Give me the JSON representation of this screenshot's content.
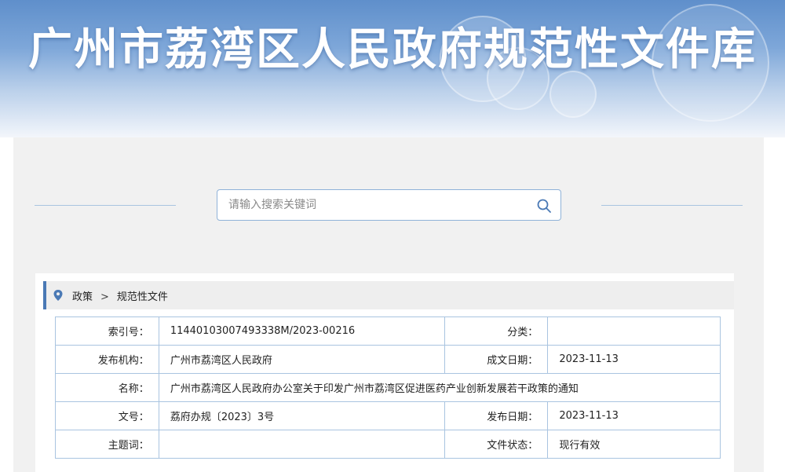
{
  "banner": {
    "title": "广州市荔湾区人民政府规范性文件库"
  },
  "search": {
    "placeholder": "请输入搜索关键词"
  },
  "breadcrumb": {
    "items": [
      "政策",
      "规范性文件"
    ],
    "separator": ">"
  },
  "meta": {
    "index_no_label": "索引号：",
    "index_no": "11440103007493338M/2023-00216",
    "category_label": "分类：",
    "category": "",
    "issuer_label": "发布机构：",
    "issuer": "广州市荔湾区人民政府",
    "written_date_label": "成文日期：",
    "written_date": "2023-11-13",
    "name_label": "名称：",
    "name": "广州市荔湾区人民政府办公室关于印发广州市荔湾区促进医药产业创新发展若干政策的通知",
    "doc_no_label": "文号：",
    "doc_no": "荔府办规〔2023〕3号",
    "publish_date_label": "发布日期：",
    "publish_date": "2023-11-13",
    "subject_label": "主题词：",
    "subject": "",
    "status_label": "文件状态：",
    "status": "现行有效"
  },
  "colors": {
    "accent": "#4a79b5",
    "border": "#a9c4e0",
    "panel": "#f1f1f1"
  },
  "icons": {
    "search": "search-icon",
    "location": "location-pin-icon"
  }
}
